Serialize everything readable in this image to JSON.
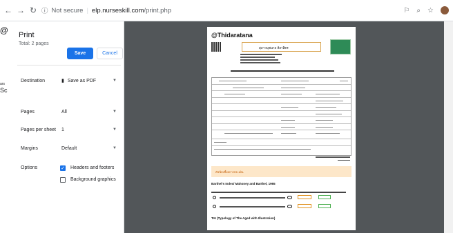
{
  "browser": {
    "security": "Not secure",
    "url_host": "elp.nurseskill.com",
    "url_path": "/print.php"
  },
  "background": {
    "items": [
      "@",
      "ars",
      "Sc"
    ]
  },
  "print": {
    "title": "Print",
    "total": "Total: 2 pages",
    "save": "Save",
    "cancel": "Cancel",
    "destination_label": "Destination",
    "destination_value": "Save as PDF",
    "pages_label": "Pages",
    "pages_value": "All",
    "pps_label": "Pages per sheet",
    "pps_value": "1",
    "margins_label": "Margins",
    "margins_value": "Default",
    "options_label": "Options",
    "opt_headers": "Headers and footers",
    "opt_headers_checked": true,
    "opt_bg": "Background graphics",
    "opt_bg_checked": false
  },
  "doc": {
    "title": "@Thidaratana",
    "name": "สุภาวนุชนาถ ลีลาลิตร",
    "section_band": "ดัชนีบ่งชี้ผลการประเมิน",
    "index_title": "Barthel's Index/ Mahoney and Barthel, 1965",
    "tai_title": "TAI (Typology of The Aged with Illustration)"
  },
  "colors": {
    "accent": "#1a73e8",
    "preview_bg": "#525659"
  }
}
